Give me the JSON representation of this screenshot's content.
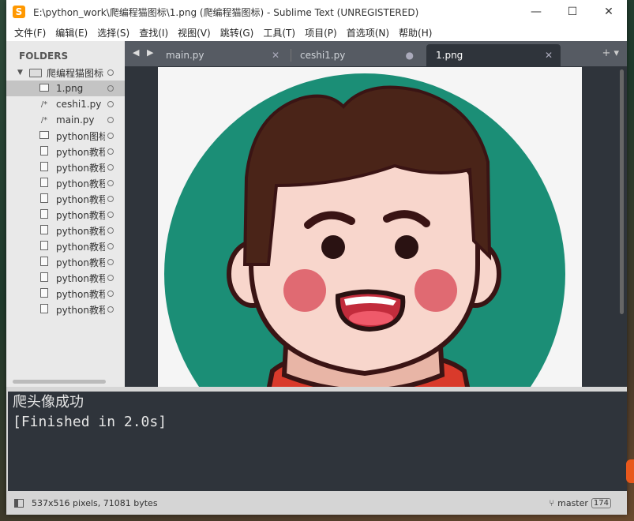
{
  "window": {
    "title": "E:\\python_work\\爬编程猫图标\\1.png (爬编程猫图标) - Sublime Text (UNREGISTERED)",
    "app_icon": "S",
    "minimize": "—",
    "maximize": "☐",
    "close": "✕"
  },
  "menu": [
    "文件(F)",
    "编辑(E)",
    "选择(S)",
    "查找(I)",
    "视图(V)",
    "跳转(G)",
    "工具(T)",
    "项目(P)",
    "首选项(N)",
    "帮助(H)"
  ],
  "sidebar": {
    "header": "FOLDERS",
    "root": "爬编程猫图标",
    "items": [
      {
        "name": "1.png",
        "type": "image",
        "selected": true
      },
      {
        "name": "ceshi1.py",
        "type": "code"
      },
      {
        "name": "main.py",
        "type": "code"
      },
      {
        "name": "python图标",
        "type": "image"
      },
      {
        "name": "python教程",
        "type": "file"
      },
      {
        "name": "python教程",
        "type": "file"
      },
      {
        "name": "python教程",
        "type": "file"
      },
      {
        "name": "python教程",
        "type": "file"
      },
      {
        "name": "python教程",
        "type": "file"
      },
      {
        "name": "python教程",
        "type": "file"
      },
      {
        "name": "python教程",
        "type": "file"
      },
      {
        "name": "python教程",
        "type": "file"
      },
      {
        "name": "python教程",
        "type": "file"
      },
      {
        "name": "python教程",
        "type": "file"
      },
      {
        "name": "python教程",
        "type": "file"
      }
    ]
  },
  "tabs": [
    {
      "label": "main.py",
      "close": "✕",
      "active": false
    },
    {
      "label": "ceshi1.py",
      "close": "●",
      "active": false
    },
    {
      "label": "1.png",
      "close": "✕",
      "active": true
    }
  ],
  "tab_nav": "◀ ▶",
  "tab_add": "+ ▾",
  "console": {
    "line1": "爬头像成功",
    "line2": "[Finished in 2.0s]"
  },
  "status": {
    "info": "537x516 pixels, 71081 bytes",
    "branch": "master",
    "branch_count": "174"
  },
  "colors": {
    "avatar_bg": "#1b8e76",
    "hair": "#4a2418",
    "skin": "#f8d6cc",
    "cheek": "#e06a72",
    "shirt": "#d93a2b"
  }
}
